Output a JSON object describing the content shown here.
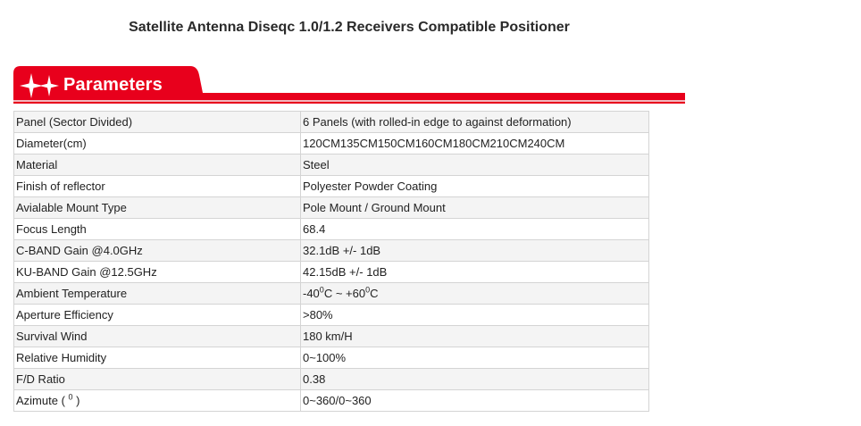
{
  "page": {
    "title": "Satellite Antenna Diseqc 1.0/1.2 Receivers Compatible Positioner"
  },
  "banner": {
    "label": "Parameters",
    "color": "#e8001c",
    "icon": "sparkle-stars-icon"
  },
  "parameters": [
    {
      "label": "Panel (Sector Divided)",
      "value": "6 Panels (with rolled-in edge to against deformation)"
    },
    {
      "label": "Diameter(cm)",
      "value": "120CM135CM150CM160CM180CM210CM240CM"
    },
    {
      "label": "Material",
      "value": "Steel"
    },
    {
      "label": "Finish of reflector",
      "value": "Polyester Powder Coating"
    },
    {
      "label": "Avialable Mount Type",
      "value": "Pole Mount / Ground Mount"
    },
    {
      "label": "Focus Length",
      "value": "68.4"
    },
    {
      "label": "C-BAND Gain @4.0GHz",
      "value": "32.1dB +/- 1dB"
    },
    {
      "label": "KU-BAND Gain @12.5GHz",
      "value": "42.15dB +/- 1dB"
    },
    {
      "label": "Ambient Temperature",
      "value_parts": [
        "-40",
        "0",
        "C ~ +60",
        "0",
        "C"
      ]
    },
    {
      "label": "Aperture Efficiency",
      "value": ">80%"
    },
    {
      "label": "Survival Wind",
      "value": "180 km/H"
    },
    {
      "label": "Relative Humidity",
      "value": "0~100%"
    },
    {
      "label": "F/D Ratio",
      "value": "0.38"
    },
    {
      "label_parts": [
        "Azimute ( ",
        "0",
        " )"
      ],
      "value": "0~360/0~360"
    }
  ]
}
